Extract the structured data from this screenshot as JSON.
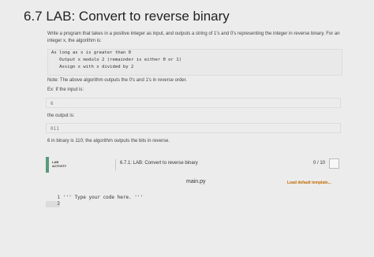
{
  "title": "6.7 LAB: Convert to reverse binary",
  "intro": "Write a program that takes in a positive integer as input, and outputs a string of 1's and 0's representing the integer in reverse binary. For an integer x, the algorithm is:",
  "algorithm": [
    "As long as x is greater than 0",
    "   Output x modulo 2 (remainder is either 0 or 1)",
    "   Assign x with x divided by 2"
  ],
  "note": "Note: The above algorithm outputs the 0's and 1's in reverse order.",
  "example_intro": "Ex: If the input is:",
  "example_input": "6",
  "output_intro": "the output is:",
  "example_output": "011",
  "explanation": "6 in binary is 110; the algorithm outputs the bits in reverse.",
  "activity": {
    "tag_line1": "LAB",
    "tag_line2": "ACTIVITY",
    "title": "6.7.1: LAB: Convert to reverse binary",
    "score": "0 / 10"
  },
  "editor": {
    "file_name": "main.py",
    "load_template": "Load default template...",
    "line_numbers": [
      "1",
      "2"
    ],
    "code": "''' Type your code here. '''"
  }
}
